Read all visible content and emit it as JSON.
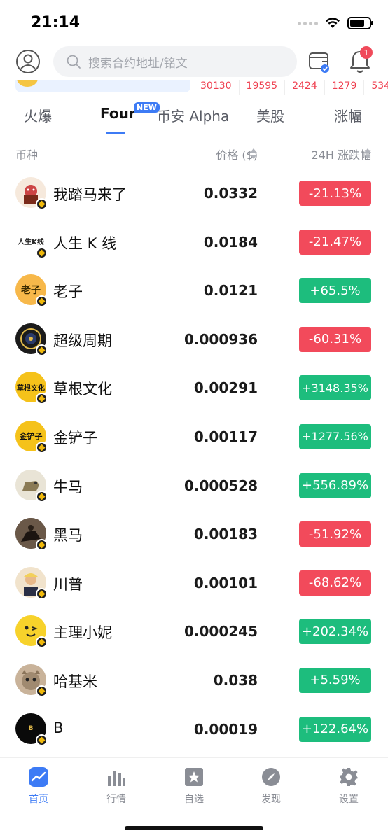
{
  "status_bar": {
    "time": "21:14"
  },
  "header": {
    "search_placeholder": "搜索合约地址/铭文",
    "notification_count": "1"
  },
  "banner": {
    "numbers": [
      "30130",
      "19595",
      "2424",
      "1279",
      "534"
    ]
  },
  "tabs": [
    {
      "label": "火爆",
      "active": false
    },
    {
      "label": "Four",
      "active": true,
      "badge": "NEW"
    },
    {
      "label": "币安 Alpha",
      "active": false
    },
    {
      "label": "美股",
      "active": false
    },
    {
      "label": "涨幅",
      "active": false
    }
  ],
  "columns": {
    "coin": "币种",
    "price": "价格 ($)",
    "change": "24H 涨跌幅"
  },
  "rows": [
    {
      "name": "我踏马来了",
      "price": "0.0332",
      "change": "-21.13%",
      "direction": "down",
      "avatar_bg": "#f6e9dc",
      "avatar_text": ""
    },
    {
      "name": "人生 K 线",
      "price": "0.0184",
      "change": "-21.47%",
      "direction": "down",
      "avatar_bg": "#ffffff",
      "avatar_text": "人生K线"
    },
    {
      "name": "老子",
      "price": "0.0121",
      "change": "+65.5%",
      "direction": "up",
      "avatar_bg": "#f7b84a",
      "avatar_text": "老子"
    },
    {
      "name": "超级周期",
      "price": "0.000936",
      "change": "-60.31%",
      "direction": "down",
      "avatar_bg": "#1b1b1b",
      "avatar_text": ""
    },
    {
      "name": "草根文化",
      "price": "0.00291",
      "change": "+3148.35%",
      "direction": "up",
      "avatar_bg": "#f5c21a",
      "avatar_text": "草根文化"
    },
    {
      "name": "金铲子",
      "price": "0.00117",
      "change": "+1277.56%",
      "direction": "up",
      "avatar_bg": "#f5c21a",
      "avatar_text": "金铲子"
    },
    {
      "name": "牛马",
      "price": "0.000528",
      "change": "+556.89%",
      "direction": "up",
      "avatar_bg": "#e9e4d6",
      "avatar_text": ""
    },
    {
      "name": "黑马",
      "price": "0.00183",
      "change": "-51.92%",
      "direction": "down",
      "avatar_bg": "#5b4a3b",
      "avatar_text": ""
    },
    {
      "name": "川普",
      "price": "0.00101",
      "change": "-68.62%",
      "direction": "down",
      "avatar_bg": "#f1e3cc",
      "avatar_text": ""
    },
    {
      "name": "主理小妮",
      "price": "0.000245",
      "change": "+202.34%",
      "direction": "up",
      "avatar_bg": "#f7d22b",
      "avatar_text": ""
    },
    {
      "name": "哈基米",
      "price": "0.038",
      "change": "+5.59%",
      "direction": "up",
      "avatar_bg": "#c9b39a",
      "avatar_text": ""
    },
    {
      "name": "B",
      "price": "0.00019",
      "change": "+122.64%",
      "direction": "up",
      "avatar_bg": "#0a0a0a",
      "avatar_text": "B"
    }
  ],
  "bottom_nav": [
    {
      "label": "首页",
      "icon": "home-chart-icon",
      "active": true
    },
    {
      "label": "行情",
      "icon": "bar-chart-icon",
      "active": false
    },
    {
      "label": "自选",
      "icon": "star-icon",
      "active": false
    },
    {
      "label": "发现",
      "icon": "compass-icon",
      "active": false
    },
    {
      "label": "设置",
      "icon": "gear-icon",
      "active": false
    }
  ],
  "colors": {
    "accent": "#3d7bf5",
    "up": "#1dbd7d",
    "down": "#f24a5b"
  }
}
